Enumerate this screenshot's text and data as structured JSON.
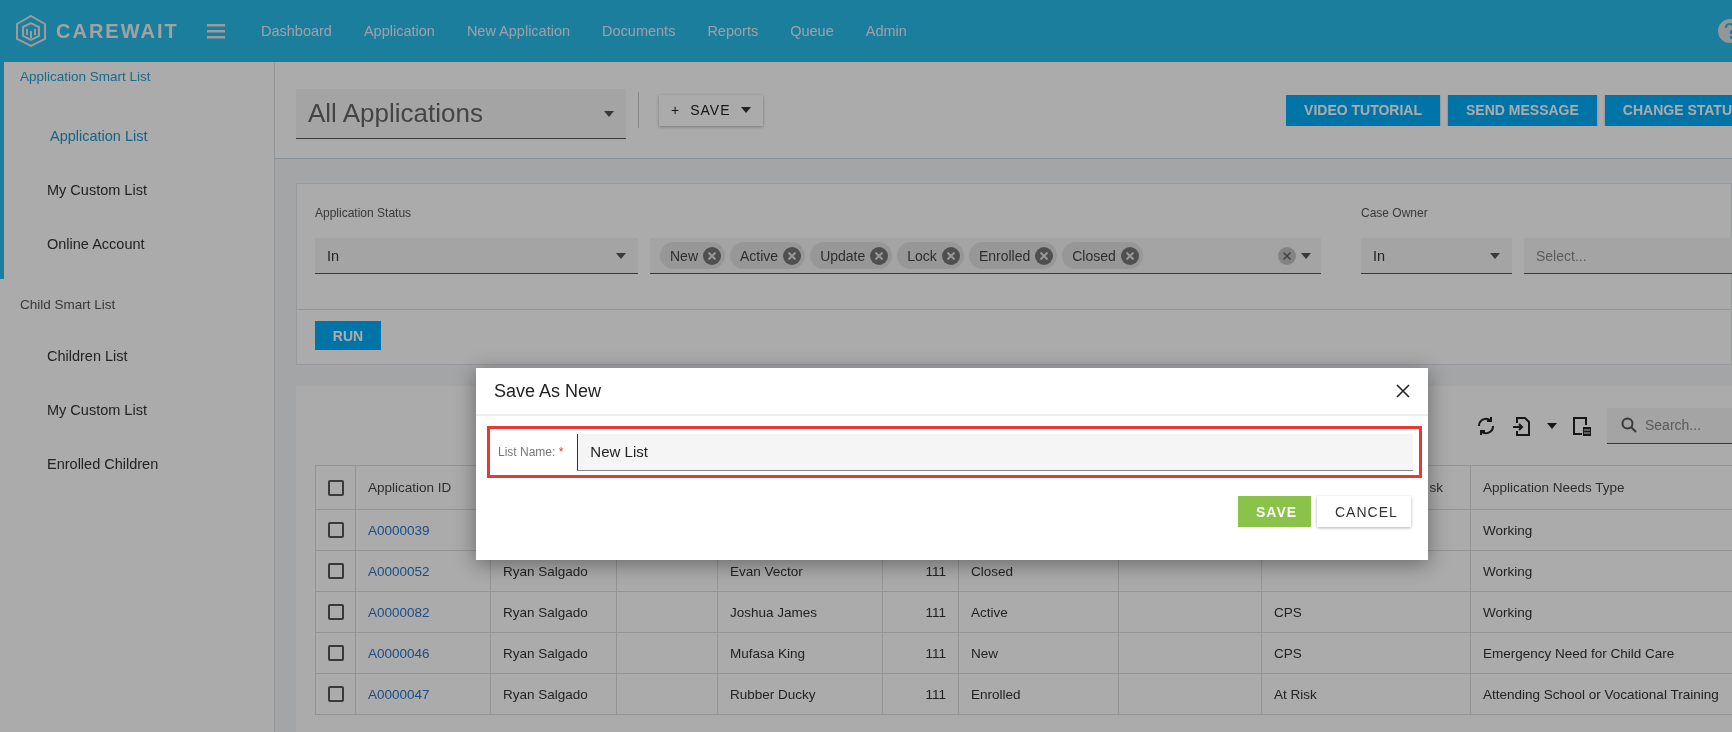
{
  "brand": {
    "name": "CAREWAIT"
  },
  "nav": [
    "Dashboard",
    "Application",
    "New Application",
    "Documents",
    "Reports",
    "Queue",
    "Admin"
  ],
  "sidebar": {
    "sections": [
      {
        "title": "Application Smart List",
        "active": true,
        "items": [
          {
            "label": "Application List",
            "selected": true
          },
          {
            "label": "My Custom List",
            "selected": false
          },
          {
            "label": "Online Account",
            "selected": false
          }
        ]
      },
      {
        "title": "Child Smart List",
        "active": false,
        "items": [
          {
            "label": "Children List",
            "selected": false
          },
          {
            "label": "My Custom List",
            "selected": false
          },
          {
            "label": "Enrolled Children",
            "selected": false
          }
        ]
      }
    ]
  },
  "list_select": {
    "value": "All Applications"
  },
  "save_button": {
    "icon": "+",
    "label": "SAVE"
  },
  "action_buttons": [
    "VIDEO TUTORIAL",
    "SEND MESSAGE",
    "CHANGE STATU"
  ],
  "filters": [
    {
      "label": "Application Status",
      "operator": "In",
      "chips": [
        "New",
        "Active",
        "Update",
        "Lock",
        "Enrolled",
        "Closed"
      ]
    },
    {
      "label": "Case Owner",
      "operator": "In",
      "placeholder": "Select..."
    }
  ],
  "run_button": "RUN",
  "search": {
    "placeholder": "Search..."
  },
  "table": {
    "header_checked": false,
    "headers": {
      "id": "Application ID",
      "column_8": "sk",
      "needs_type": "Application Needs Type"
    },
    "rows": [
      {
        "checked": false,
        "id": "A0000039",
        "needs_type": "Working"
      },
      {
        "checked": false,
        "id": "A0000052",
        "column_2": "Ryan Salgado",
        "column_4": "Evan Vector",
        "column_5": "111",
        "column_6": "Closed",
        "needs_type": "Working"
      },
      {
        "checked": false,
        "id": "A0000082",
        "column_2": "Ryan Salgado",
        "column_4": "Joshua James",
        "column_5": "111",
        "column_6": "Active",
        "column_8": "CPS",
        "needs_type": "Working"
      },
      {
        "checked": false,
        "id": "A0000046",
        "column_2": "Ryan Salgado",
        "column_4": "Mufasa King",
        "column_5": "111",
        "column_6": "New",
        "column_8": "CPS",
        "needs_type": "Emergency Need for Child Care"
      },
      {
        "checked": false,
        "id": "A0000047",
        "column_2": "Ryan Salgado",
        "column_4": "Rubber Ducky",
        "column_5": "111",
        "column_6": "Enrolled",
        "column_8": "At Risk",
        "needs_type": "Attending School or Vocational Training"
      }
    ]
  },
  "dialog": {
    "title": "Save As New",
    "field_label": "List Name:",
    "required_mark": "*",
    "field_value": "New List",
    "highlighted": true,
    "buttons": [
      {
        "kind": "primary",
        "label": "SAVE"
      },
      {
        "kind": "secondary",
        "label": "CANCEL"
      }
    ]
  }
}
